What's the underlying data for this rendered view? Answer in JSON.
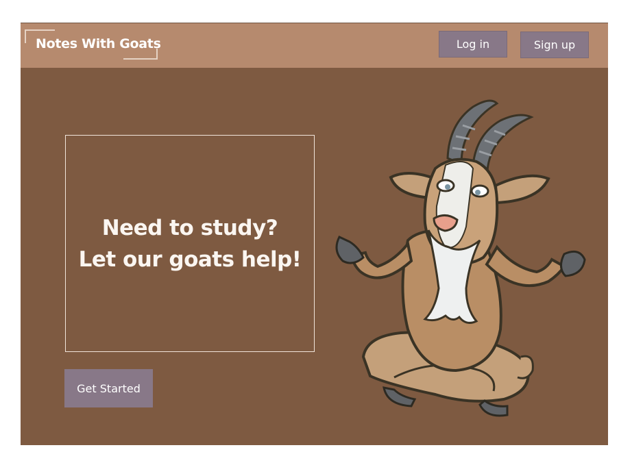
{
  "brand": {
    "name": "Notes With Goats"
  },
  "nav": {
    "login_label": "Log in",
    "signup_label": "Sign up"
  },
  "hero": {
    "line1": "Need to study?",
    "line2": "Let our goats help!",
    "cta_label": "Get Started"
  },
  "illustration": {
    "icon": "meditating-goat-illustration"
  },
  "colors": {
    "page_bg": "#7e5a41",
    "navbar_bg": "#b68a6e",
    "button_bg": "#887888",
    "text": "#ffffff"
  }
}
